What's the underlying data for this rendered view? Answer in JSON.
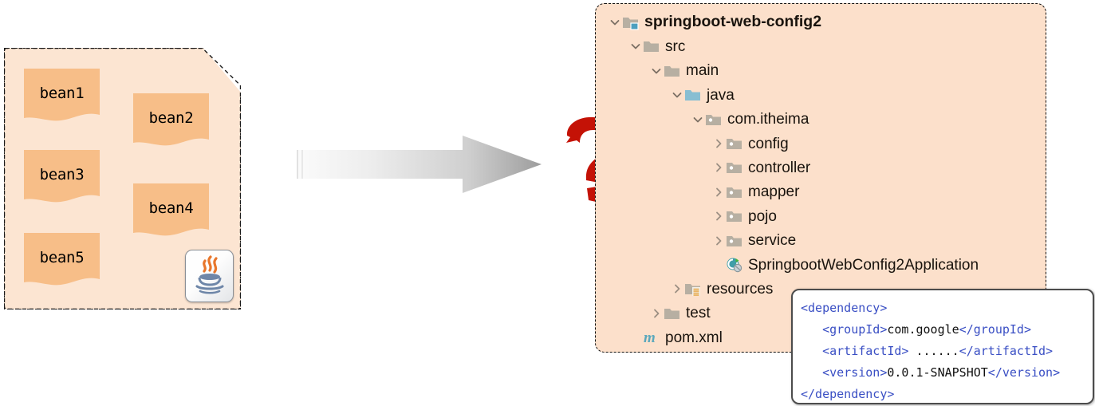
{
  "beans_panel": {
    "name": "bean-container",
    "background_color": "#FCE5D2",
    "card_color": "#F7BE88",
    "cards": [
      {
        "label": "bean1"
      },
      {
        "label": "bean2"
      },
      {
        "label": "bean3"
      },
      {
        "label": "bean4"
      },
      {
        "label": "bean5"
      }
    ],
    "logo_icon": "java-icon"
  },
  "flow": {
    "arrow_icon": "right-arrow-icon",
    "question_icon": "question-mark-icon",
    "question_color": "#C41206"
  },
  "project_tree": {
    "background_color": "#FCE0CB",
    "rows": [
      {
        "label": "springboot-web-config2",
        "twisty": "chevron-down-icon",
        "icon": "module-folder-icon",
        "depth": 0,
        "bold": true
      },
      {
        "label": "src",
        "twisty": "chevron-down-icon",
        "icon": "folder-icon",
        "depth": 1,
        "bold": false
      },
      {
        "label": "main",
        "twisty": "chevron-down-icon",
        "icon": "folder-icon",
        "depth": 2,
        "bold": false
      },
      {
        "label": "java",
        "twisty": "chevron-down-icon",
        "icon": "source-folder-icon",
        "depth": 3,
        "bold": false
      },
      {
        "label": "com.itheima",
        "twisty": "chevron-down-icon",
        "icon": "package-icon",
        "depth": 4,
        "bold": false
      },
      {
        "label": "config",
        "twisty": "chevron-right-icon",
        "icon": "package-icon",
        "depth": 5,
        "bold": false
      },
      {
        "label": "controller",
        "twisty": "chevron-right-icon",
        "icon": "package-icon",
        "depth": 5,
        "bold": false
      },
      {
        "label": "mapper",
        "twisty": "chevron-right-icon",
        "icon": "package-icon",
        "depth": 5,
        "bold": false
      },
      {
        "label": "pojo",
        "twisty": "chevron-right-icon",
        "icon": "package-icon",
        "depth": 5,
        "bold": false
      },
      {
        "label": "service",
        "twisty": "chevron-right-icon",
        "icon": "package-icon",
        "depth": 5,
        "bold": false
      },
      {
        "label": "SpringbootWebConfig2Application",
        "twisty": "none",
        "icon": "spring-boot-class-icon",
        "depth": 5,
        "bold": false
      },
      {
        "label": "resources",
        "twisty": "chevron-right-icon",
        "icon": "resources-folder-icon",
        "depth": 3,
        "bold": false
      },
      {
        "label": "test",
        "twisty": "chevron-right-icon",
        "icon": "folder-icon",
        "depth": 2,
        "bold": false
      },
      {
        "label": "pom.xml",
        "twisty": "none",
        "icon": "maven-icon",
        "depth": 1,
        "bold": false
      }
    ]
  },
  "xml_popup": {
    "lines": [
      {
        "indent": 0,
        "parts": [
          {
            "t": "tag",
            "v": "<dependency>"
          }
        ]
      },
      {
        "indent": 1,
        "parts": [
          {
            "t": "tag",
            "v": "<groupId>"
          },
          {
            "t": "text",
            "v": "com.google"
          },
          {
            "t": "tag",
            "v": "</groupId>"
          }
        ]
      },
      {
        "indent": 1,
        "parts": [
          {
            "t": "tag",
            "v": "<artifactId>"
          },
          {
            "t": "text",
            "v": " ......"
          },
          {
            "t": "tag",
            "v": "</artifactId>"
          }
        ]
      },
      {
        "indent": 1,
        "parts": [
          {
            "t": "tag",
            "v": "<version>"
          },
          {
            "t": "text",
            "v": "0.0.1-SNAPSHOT"
          },
          {
            "t": "tag",
            "v": "</version>"
          }
        ]
      },
      {
        "indent": 0,
        "parts": [
          {
            "t": "tag",
            "v": "</dependency>"
          }
        ]
      }
    ],
    "tag_color": "#3a4fc4",
    "text_color": "#111111"
  }
}
